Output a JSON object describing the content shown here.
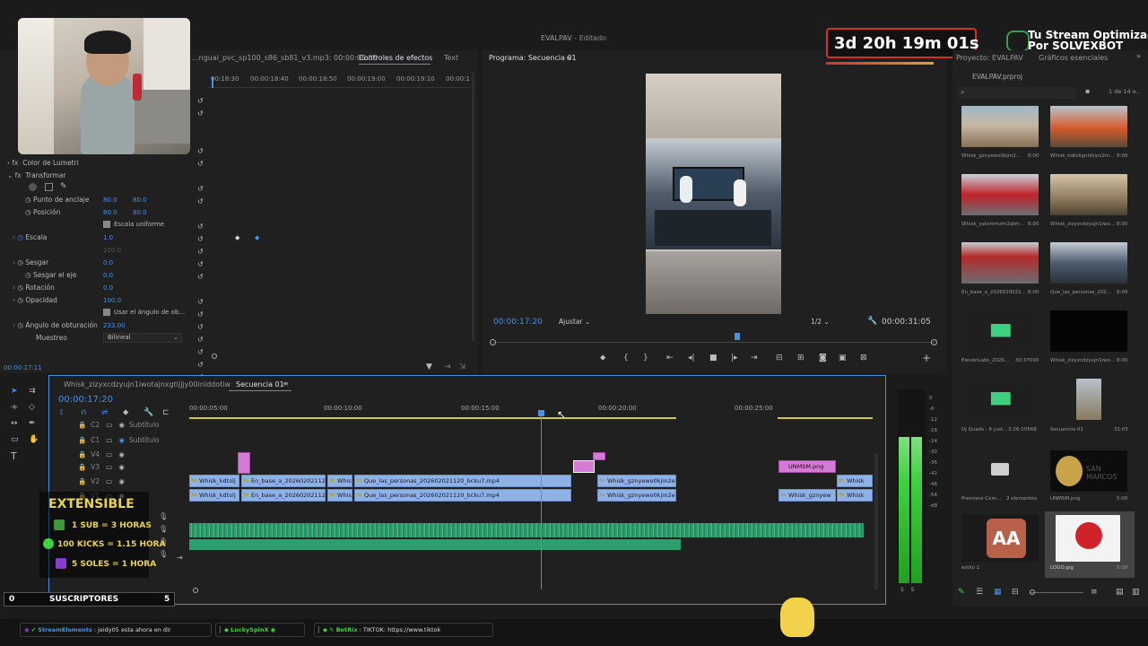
{
  "window": {
    "title": "EVALPAV",
    "status": "Editado"
  },
  "stream_overlay": {
    "countdown": "3d 20h 19m 01s",
    "optimized_line1": "Tu Stream Optimizado",
    "optimized_line2": "Por SOLVEXBOT",
    "extensible": "EXTENSIBLE",
    "rules": [
      "1 SUB = 3 HORAS",
      "100 KICKS = 1.15 HORA",
      "5 SOLES = 1 HORA"
    ],
    "subs_left": "0",
    "subs_label": "SUSCRIPTORES",
    "subs_right": "5",
    "chat": [
      {
        "user": "StreamElements",
        "msg": "jeidy05 esta ahora en dir"
      },
      {
        "user": "LuckySpinX",
        "msg": ""
      },
      {
        "user": "BotRix",
        "msg": "TIKTOK: https://www.tiktok"
      }
    ]
  },
  "effect_controls": {
    "source_tab": "...ngual_pvc_sp100_s86_sb81_v3.mp3: 00:00:06:38",
    "tab_active": "Controles de efectos",
    "tab_text": "Text",
    "ruler": [
      "00:18:30",
      "00:00:18:40",
      "00:00:18:50",
      "00:00:19:00",
      "00:00:19:10",
      "00:00:1"
    ],
    "fx_lumetri": "Color de Lumetri",
    "fx_transform": "Transformar",
    "props": [
      {
        "name": "Punto de anclaje",
        "v1": "80.0",
        "v2": "80.0"
      },
      {
        "name": "Posición",
        "v1": "80.0",
        "v2": "80.0"
      },
      {
        "name": "Escala uniforme",
        "v1": "",
        "v2": ""
      },
      {
        "name": "Escala",
        "v1": "1.0",
        "v2": ""
      },
      {
        "name": "Sesgar",
        "v1": "0.0",
        "v2": ""
      },
      {
        "name": "Sesgar el eje",
        "v1": "0.0",
        "v2": ""
      },
      {
        "name": "Rotación",
        "v1": "0.0",
        "v2": ""
      },
      {
        "name": "Opacidad",
        "v1": "100.0",
        "v2": ""
      },
      {
        "name": "Usar el ángulo de ob...",
        "v1": "",
        "v2": ""
      },
      {
        "name": "Ángulo de obturación",
        "v1": "233.00",
        "v2": ""
      },
      {
        "name": "Muestreo",
        "v1": "Bilineal",
        "v2": ""
      }
    ],
    "scale_extra": "100.0",
    "timecode": "00:00:17:11"
  },
  "program_monitor": {
    "title": "Programa: Secuencia 01",
    "timecode": "00:00:17:20",
    "fit": "Ajustar",
    "quality": "1/2",
    "duration": "00:00:31:05"
  },
  "timeline": {
    "tab1": "Whisk_zizyxcdzyujn1iwotajnxgtljjjy00inlddotiw",
    "tab2": "Secuencia 01",
    "timecode": "00:00:17:20",
    "ruler": [
      "00:00:05:00",
      "00:00:10:00",
      "00:00:15:00",
      "00:00:20:00",
      "00:00:25:00"
    ],
    "tracks": [
      {
        "id": "C2",
        "name": "Subtítulo"
      },
      {
        "id": "C1",
        "name": "Subtítulo"
      },
      {
        "id": "V4",
        "name": ""
      },
      {
        "id": "V3",
        "name": ""
      },
      {
        "id": "V2",
        "name": ""
      },
      {
        "id": "V1",
        "name": ""
      }
    ],
    "clips_v2": [
      "Whisk_kdtolj",
      "En_base_a_20260202112",
      "Whis",
      "Que_las_personas_202602021120_bcku7.mp4",
      "Whisk_gznyewo0kjm2e",
      "UNMSM.png",
      "Whisk"
    ],
    "clips_v1": [
      "Whisk_kdtolj",
      "En_base_a_20260202112",
      "Whis",
      "Que_las_personas_202602021120_bcku7.mp4",
      "Whisk_gznyewo0kjm2e",
      "Whisk_gznyew",
      "Whisk"
    ],
    "meter_scale": [
      "0",
      "-6",
      "-12",
      "-18",
      "-24",
      "-30",
      "-36",
      "-42",
      "-48",
      "-54",
      "-dB"
    ]
  },
  "project": {
    "tab1": "Proyecto: EVALPAV",
    "tab2": "Gráficos esenciales",
    "file": "EVALPAV.prproj",
    "count": "1 de 14 e...",
    "items": [
      {
        "name": "Whisk_gznyewo0kjm2...",
        "dur": "8:00"
      },
      {
        "name": "Whisk_kdtolignhfzyiz2m...",
        "dur": "8:00"
      },
      {
        "name": "Whisk_yatommzm2qtm...",
        "dur": "8:00"
      },
      {
        "name": "Whisk_zizyxcdzyujn1iwo...",
        "dur": "8:00"
      },
      {
        "name": "En_base_a_2026020021...",
        "dur": "8:00"
      },
      {
        "name": "Que_las_personas_202...",
        "dur": "8:00"
      },
      {
        "name": "ElevenLabs_2026...",
        "dur": "30:37000"
      },
      {
        "name": "Whisk_zizyxcdzyujn1iwo...",
        "dur": "8:00"
      },
      {
        "name": "Dj Quads - It just...",
        "dur": "3:26:10568"
      },
      {
        "name": "Secuencia 01",
        "dur": "31:05"
      },
      {
        "name": "Premiere Com...",
        "dur": "2 elementos"
      },
      {
        "name": "UNMSM.png",
        "dur": "5:00"
      },
      {
        "name": "estilo 1",
        "dur": ""
      },
      {
        "name": "LOGO.jpg",
        "dur": "5:00"
      }
    ]
  },
  "colors": {
    "accent": "#4a90e2",
    "clip_blue": "#8fb2e6",
    "clip_pink": "#d57bd5",
    "audio_green": "#3fbf7f",
    "countdown_border": "#d0322d"
  }
}
